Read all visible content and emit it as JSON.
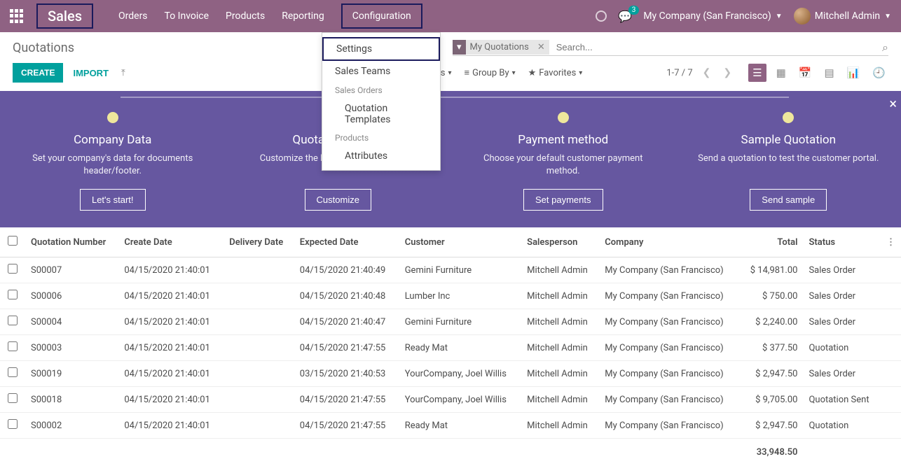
{
  "topbar": {
    "brand": "Sales",
    "menu": [
      "Orders",
      "To Invoice",
      "Products",
      "Reporting",
      "Configuration"
    ],
    "chat_badge": "3",
    "company": "My Company (San Francisco)",
    "user": "Mitchell Admin"
  },
  "dropdown": {
    "settings": "Settings",
    "sales_teams": "Sales Teams",
    "sales_orders_hdr": "Sales Orders",
    "quotation_templates": "Quotation Templates",
    "products_hdr": "Products",
    "attributes": "Attributes"
  },
  "page": {
    "title": "Quotations",
    "filter_tag": "My Quotations",
    "search_placeholder": "Search...",
    "create": "CREATE",
    "import": "IMPORT",
    "filters": "Filters",
    "groupby": "Group By",
    "favorites": "Favorites",
    "pager": "1-7 / 7"
  },
  "onboard": {
    "close": "×",
    "steps": [
      {
        "title": "Company Data",
        "desc": "Set your company's data for documents header/footer.",
        "btn": "Let's start!"
      },
      {
        "title": "Quotation Layout",
        "desc": "Customize the look of your quotations.",
        "btn": "Customize"
      },
      {
        "title": "Payment method",
        "desc": "Choose your default customer payment method.",
        "btn": "Set payments"
      },
      {
        "title": "Sample Quotation",
        "desc": "Send a quotation to test the customer portal.",
        "btn": "Send sample"
      }
    ]
  },
  "table": {
    "headers": {
      "number": "Quotation Number",
      "create": "Create Date",
      "delivery": "Delivery Date",
      "expected": "Expected Date",
      "customer": "Customer",
      "sales": "Salesperson",
      "company": "Company",
      "total": "Total",
      "status": "Status"
    },
    "rows": [
      {
        "number": "S00007",
        "create": "04/15/2020 21:40:01",
        "delivery": "",
        "expected": "04/15/2020 21:40:49",
        "customer": "Gemini Furniture",
        "sales": "Mitchell Admin",
        "company": "My Company (San Francisco)",
        "total": "$ 14,981.00",
        "status": "Sales Order"
      },
      {
        "number": "S00006",
        "create": "04/15/2020 21:40:01",
        "delivery": "",
        "expected": "04/15/2020 21:40:48",
        "customer": "Lumber Inc",
        "sales": "Mitchell Admin",
        "company": "My Company (San Francisco)",
        "total": "$ 750.00",
        "status": "Sales Order"
      },
      {
        "number": "S00004",
        "create": "04/15/2020 21:40:01",
        "delivery": "",
        "expected": "04/15/2020 21:40:47",
        "customer": "Gemini Furniture",
        "sales": "Mitchell Admin",
        "company": "My Company (San Francisco)",
        "total": "$ 2,240.00",
        "status": "Sales Order"
      },
      {
        "number": "S00003",
        "create": "04/15/2020 21:40:01",
        "delivery": "",
        "expected": "04/15/2020 21:47:55",
        "customer": "Ready Mat",
        "sales": "Mitchell Admin",
        "company": "My Company (San Francisco)",
        "total": "$ 377.50",
        "status": "Quotation"
      },
      {
        "number": "S00019",
        "create": "04/15/2020 21:40:01",
        "delivery": "",
        "expected": "03/15/2020 21:40:53",
        "customer": "YourCompany, Joel Willis",
        "sales": "Mitchell Admin",
        "company": "My Company (San Francisco)",
        "total": "$ 2,947.50",
        "status": "Sales Order"
      },
      {
        "number": "S00018",
        "create": "04/15/2020 21:40:01",
        "delivery": "",
        "expected": "04/15/2020 21:47:55",
        "customer": "YourCompany, Joel Willis",
        "sales": "Mitchell Admin",
        "company": "My Company (San Francisco)",
        "total": "$ 9,705.00",
        "status": "Quotation Sent"
      },
      {
        "number": "S00002",
        "create": "04/15/2020 21:40:01",
        "delivery": "",
        "expected": "04/15/2020 21:47:55",
        "customer": "Ready Mat",
        "sales": "Mitchell Admin",
        "company": "My Company (San Francisco)",
        "total": "$ 2,947.50",
        "status": "Quotation"
      }
    ],
    "footer_total": "33,948.50"
  }
}
